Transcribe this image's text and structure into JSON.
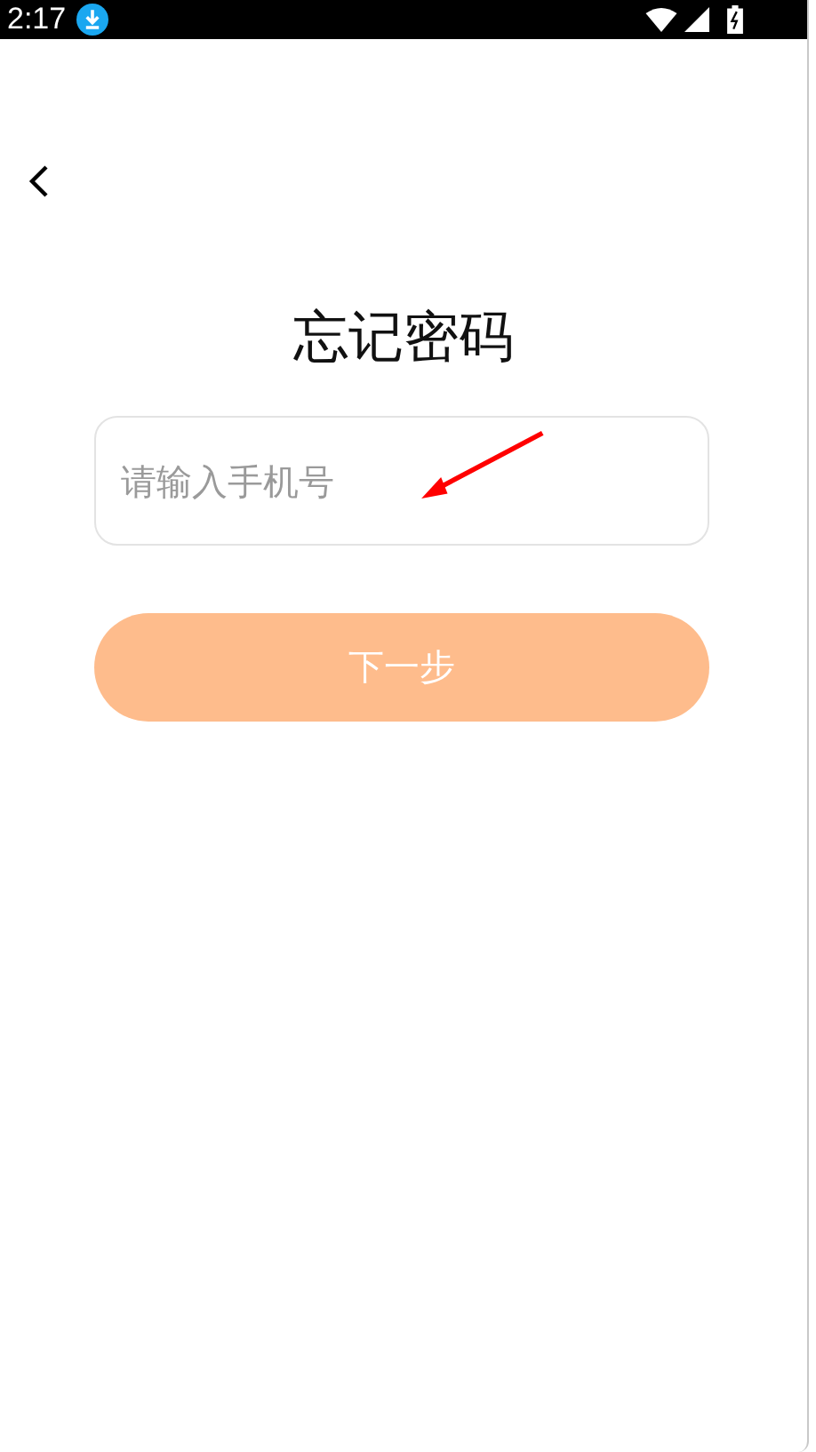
{
  "status_bar": {
    "time": "2:17"
  },
  "title": "忘记密码",
  "phone_field": {
    "placeholder": "请输入手机号"
  },
  "next_button": {
    "label": "下一步",
    "disabled": true
  }
}
